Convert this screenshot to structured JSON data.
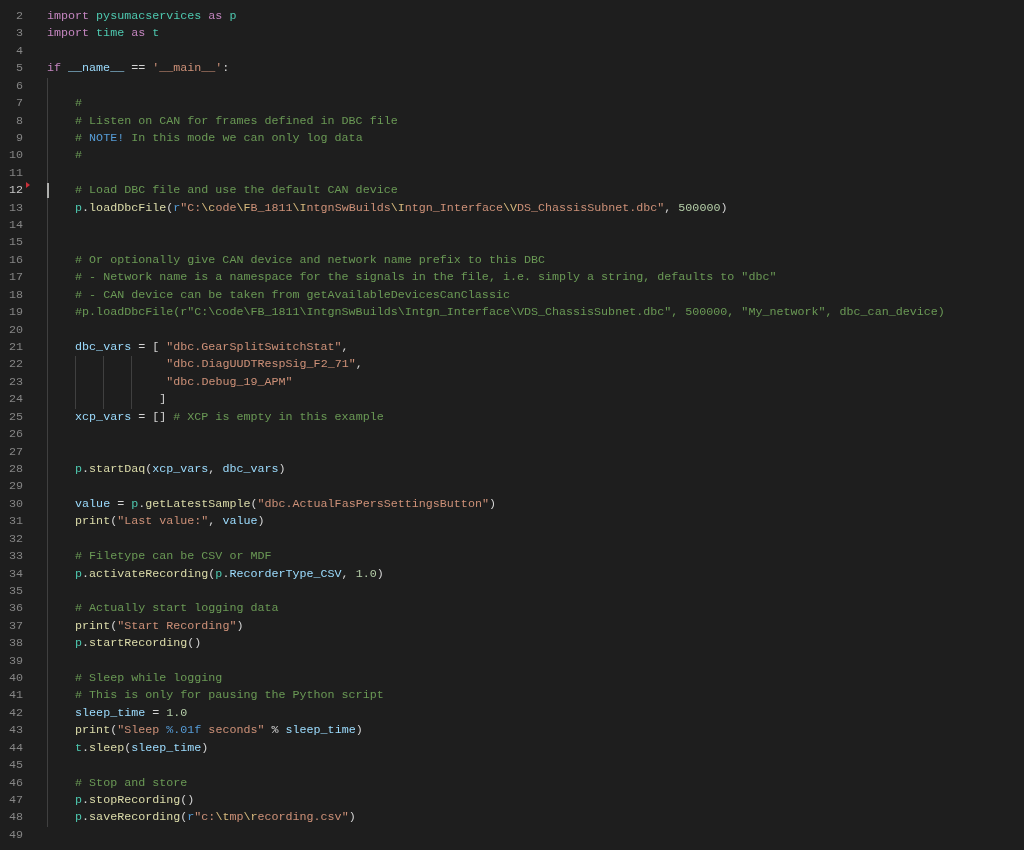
{
  "editor": {
    "lines": [
      {
        "number": "2",
        "active": false,
        "tokens": [
          {
            "kind": "kw",
            "text": "import "
          },
          {
            "kind": "mod",
            "text": "pysumacservices "
          },
          {
            "kind": "kw",
            "text": "as "
          },
          {
            "kind": "mod",
            "text": "p"
          }
        ]
      },
      {
        "number": "3",
        "active": false,
        "tokens": [
          {
            "kind": "kw",
            "text": "import "
          },
          {
            "kind": "mod",
            "text": "time "
          },
          {
            "kind": "kw",
            "text": "as "
          },
          {
            "kind": "mod",
            "text": "t"
          }
        ]
      },
      {
        "number": "4",
        "active": false
      },
      {
        "number": "5",
        "active": false,
        "tokens": [
          {
            "kind": "kw",
            "text": "if "
          },
          {
            "kind": "var",
            "text": "__name__"
          },
          {
            "kind": "punc",
            "text": " == "
          },
          {
            "kind": "str",
            "text": "'__main__'"
          },
          {
            "kind": "punc",
            "text": ":"
          }
        ],
        "children": [
          {
            "number": "6",
            "active": false
          },
          {
            "number": "7",
            "active": false,
            "tokens": [
              {
                "kind": "cmt",
                "text": "#"
              }
            ]
          },
          {
            "number": "8",
            "active": false,
            "tokens": [
              {
                "kind": "cmt",
                "text": "# Listen on CAN for frames defined in DBC file"
              }
            ]
          },
          {
            "number": "9",
            "active": false,
            "tokens": [
              {
                "kind": "cmt",
                "text": "# "
              },
              {
                "kind": "const",
                "text": "NOTE!"
              },
              {
                "kind": "cmt",
                "text": " In this mode we can only log data"
              }
            ]
          },
          {
            "number": "10",
            "active": false,
            "tokens": [
              {
                "kind": "cmt",
                "text": "#"
              }
            ]
          },
          {
            "number": "11",
            "active": false
          },
          {
            "number": "12",
            "active": true,
            "tokens": [
              {
                "kind": "cmt",
                "text": "# Load DBC file and use the default CAN device"
              }
            ]
          },
          {
            "number": "13",
            "active": false,
            "tokens": [
              {
                "kind": "mod",
                "text": "p"
              },
              {
                "kind": "punc",
                "text": "."
              },
              {
                "kind": "fn",
                "text": "loadDbcFile"
              },
              {
                "kind": "punc",
                "text": "("
              },
              {
                "kind": "const",
                "text": "r"
              },
              {
                "kind": "str",
                "text": "\"C:"
              },
              {
                "kind": "esc",
                "text": "\\c"
              },
              {
                "kind": "str",
                "text": "ode"
              },
              {
                "kind": "esc",
                "text": "\\F"
              },
              {
                "kind": "str",
                "text": "B_1811"
              },
              {
                "kind": "esc",
                "text": "\\I"
              },
              {
                "kind": "str",
                "text": "ntgnSwBuilds"
              },
              {
                "kind": "esc",
                "text": "\\I"
              },
              {
                "kind": "str",
                "text": "ntgn_Interface"
              },
              {
                "kind": "esc",
                "text": "\\V"
              },
              {
                "kind": "str",
                "text": "DS_ChassisSubnet.dbc\""
              },
              {
                "kind": "punc",
                "text": ", "
              },
              {
                "kind": "num",
                "text": "500000"
              },
              {
                "kind": "punc",
                "text": ")"
              }
            ]
          },
          {
            "number": "14",
            "active": false
          },
          {
            "number": "15",
            "active": false
          },
          {
            "number": "16",
            "active": false,
            "tokens": [
              {
                "kind": "cmt",
                "text": "# Or optionally give CAN device and network name prefix to this DBC"
              }
            ]
          },
          {
            "number": "17",
            "active": false,
            "tokens": [
              {
                "kind": "cmt",
                "text": "# - Network name is a namespace for the signals in the file, i.e. simply a string, defaults to \"dbc\""
              }
            ]
          },
          {
            "number": "18",
            "active": false,
            "tokens": [
              {
                "kind": "cmt",
                "text": "# - CAN device can be taken from getAvailableDevicesCanClassic"
              }
            ]
          },
          {
            "number": "19",
            "active": false,
            "tokens": [
              {
                "kind": "cmt",
                "text": "#p.loadDbcFile(r\"C:\\code\\FB_1811\\IntgnSwBuilds\\Intgn_Interface\\VDS_ChassisSubnet.dbc\", 500000, \"My_network\", dbc_can_device)"
              }
            ]
          },
          {
            "number": "20",
            "active": false
          },
          {
            "number": "21",
            "active": false,
            "tokens": [
              {
                "kind": "var",
                "text": "dbc_vars"
              },
              {
                "kind": "punc",
                "text": " = [ "
              },
              {
                "kind": "str",
                "text": "\"dbc.GearSplitSwitchStat\""
              },
              {
                "kind": "punc",
                "text": ","
              }
            ]
          },
          {
            "number": "22",
            "active": false,
            "tokens": [
              {
                "kind": "str",
                "text": "             \"dbc.DiagUUDTRespSig_F2_71\""
              },
              {
                "kind": "punc",
                "text": ","
              }
            ]
          },
          {
            "number": "23",
            "active": false,
            "tokens": [
              {
                "kind": "str",
                "text": "             \"dbc.Debug_19_APM\""
              }
            ]
          },
          {
            "number": "24",
            "active": false,
            "tokens": [
              {
                "kind": "punc",
                "text": "            ]"
              }
            ]
          },
          {
            "number": "25",
            "active": false,
            "tokens": [
              {
                "kind": "var",
                "text": "xcp_vars"
              },
              {
                "kind": "punc",
                "text": " = [] "
              },
              {
                "kind": "cmt",
                "text": "# XCP is empty in this example"
              }
            ]
          },
          {
            "number": "26",
            "active": false
          },
          {
            "number": "27",
            "active": false
          },
          {
            "number": "28",
            "active": false,
            "tokens": [
              {
                "kind": "mod",
                "text": "p"
              },
              {
                "kind": "punc",
                "text": "."
              },
              {
                "kind": "fn",
                "text": "startDaq"
              },
              {
                "kind": "punc",
                "text": "("
              },
              {
                "kind": "var",
                "text": "xcp_vars"
              },
              {
                "kind": "punc",
                "text": ", "
              },
              {
                "kind": "var",
                "text": "dbc_vars"
              },
              {
                "kind": "punc",
                "text": ")"
              }
            ]
          },
          {
            "number": "29",
            "active": false
          },
          {
            "number": "30",
            "active": false,
            "tokens": [
              {
                "kind": "var",
                "text": "value"
              },
              {
                "kind": "punc",
                "text": " = "
              },
              {
                "kind": "mod",
                "text": "p"
              },
              {
                "kind": "punc",
                "text": "."
              },
              {
                "kind": "fn",
                "text": "getLatestSample"
              },
              {
                "kind": "punc",
                "text": "("
              },
              {
                "kind": "str",
                "text": "\"dbc.ActualFasPersSettingsButton\""
              },
              {
                "kind": "punc",
                "text": ")"
              }
            ]
          },
          {
            "number": "31",
            "active": false,
            "tokens": [
              {
                "kind": "fn",
                "text": "print"
              },
              {
                "kind": "punc",
                "text": "("
              },
              {
                "kind": "str",
                "text": "\"Last value:\""
              },
              {
                "kind": "punc",
                "text": ", "
              },
              {
                "kind": "var",
                "text": "value"
              },
              {
                "kind": "punc",
                "text": ")"
              }
            ]
          },
          {
            "number": "32",
            "active": false
          },
          {
            "number": "33",
            "active": false,
            "tokens": [
              {
                "kind": "cmt",
                "text": "# Filetype can be CSV or MDF"
              }
            ]
          },
          {
            "number": "34",
            "active": false,
            "tokens": [
              {
                "kind": "mod",
                "text": "p"
              },
              {
                "kind": "punc",
                "text": "."
              },
              {
                "kind": "fn",
                "text": "activateRecording"
              },
              {
                "kind": "punc",
                "text": "("
              },
              {
                "kind": "mod",
                "text": "p"
              },
              {
                "kind": "punc",
                "text": "."
              },
              {
                "kind": "var",
                "text": "RecorderType_CSV"
              },
              {
                "kind": "punc",
                "text": ", "
              },
              {
                "kind": "num",
                "text": "1.0"
              },
              {
                "kind": "punc",
                "text": ")"
              }
            ]
          },
          {
            "number": "35",
            "active": false
          },
          {
            "number": "36",
            "active": false,
            "tokens": [
              {
                "kind": "cmt",
                "text": "# Actually start logging data"
              }
            ]
          },
          {
            "number": "37",
            "active": false,
            "tokens": [
              {
                "kind": "fn",
                "text": "print"
              },
              {
                "kind": "punc",
                "text": "("
              },
              {
                "kind": "str",
                "text": "\"Start Recording\""
              },
              {
                "kind": "punc",
                "text": ")"
              }
            ]
          },
          {
            "number": "38",
            "active": false,
            "tokens": [
              {
                "kind": "mod",
                "text": "p"
              },
              {
                "kind": "punc",
                "text": "."
              },
              {
                "kind": "fn",
                "text": "startRecording"
              },
              {
                "kind": "punc",
                "text": "()"
              }
            ]
          },
          {
            "number": "39",
            "active": false
          },
          {
            "number": "40",
            "active": false,
            "tokens": [
              {
                "kind": "cmt",
                "text": "# Sleep while logging"
              }
            ]
          },
          {
            "number": "41",
            "active": false,
            "tokens": [
              {
                "kind": "cmt",
                "text": "# This is only for pausing the Python script"
              }
            ]
          },
          {
            "number": "42",
            "active": false,
            "tokens": [
              {
                "kind": "var",
                "text": "sleep_time"
              },
              {
                "kind": "punc",
                "text": " = "
              },
              {
                "kind": "num",
                "text": "1.0"
              }
            ]
          },
          {
            "number": "43",
            "active": false,
            "tokens": [
              {
                "kind": "fn",
                "text": "print"
              },
              {
                "kind": "punc",
                "text": "("
              },
              {
                "kind": "str",
                "text": "\"Sleep "
              },
              {
                "kind": "const",
                "text": "%.01f"
              },
              {
                "kind": "str",
                "text": " seconds\""
              },
              {
                "kind": "punc",
                "text": " % "
              },
              {
                "kind": "var",
                "text": "sleep_time"
              },
              {
                "kind": "punc",
                "text": ")"
              }
            ]
          },
          {
            "number": "44",
            "active": false,
            "tokens": [
              {
                "kind": "mod",
                "text": "t"
              },
              {
                "kind": "punc",
                "text": "."
              },
              {
                "kind": "fn",
                "text": "sleep"
              },
              {
                "kind": "punc",
                "text": "("
              },
              {
                "kind": "var",
                "text": "sleep_time"
              },
              {
                "kind": "punc",
                "text": ")"
              }
            ]
          },
          {
            "number": "45",
            "active": false
          },
          {
            "number": "46",
            "active": false,
            "tokens": [
              {
                "kind": "cmt",
                "text": "# Stop and store"
              }
            ]
          },
          {
            "number": "47",
            "active": false,
            "tokens": [
              {
                "kind": "mod",
                "text": "p"
              },
              {
                "kind": "punc",
                "text": "."
              },
              {
                "kind": "fn",
                "text": "stopRecording"
              },
              {
                "kind": "punc",
                "text": "()"
              }
            ]
          },
          {
            "number": "48",
            "active": false,
            "tokens": [
              {
                "kind": "mod",
                "text": "p"
              },
              {
                "kind": "punc",
                "text": "."
              },
              {
                "kind": "fn",
                "text": "saveRecording"
              },
              {
                "kind": "punc",
                "text": "("
              },
              {
                "kind": "const",
                "text": "r"
              },
              {
                "kind": "str",
                "text": "\"c:"
              },
              {
                "kind": "esc",
                "text": "\\t"
              },
              {
                "kind": "str",
                "text": "mp"
              },
              {
                "kind": "esc",
                "text": "\\r"
              },
              {
                "kind": "str",
                "text": "ecording.csv\""
              },
              {
                "kind": "punc",
                "text": ")"
              }
            ]
          }
        ]
      },
      {
        "number": "49",
        "active": false
      }
    ]
  }
}
